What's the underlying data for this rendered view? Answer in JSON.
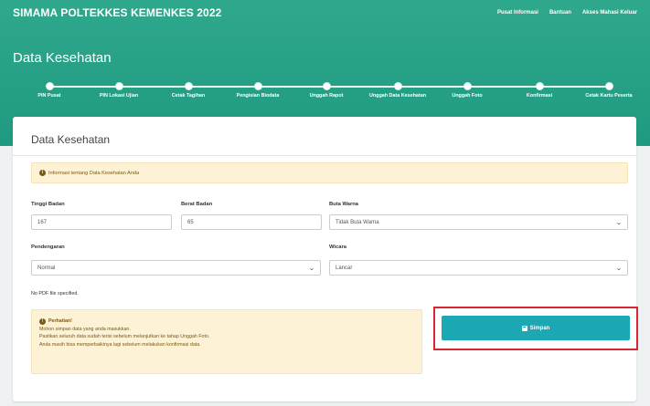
{
  "app": {
    "title": "SIMAMA POLTEKKES KEMENKES 2022"
  },
  "topnav": {
    "links": [
      "Pusat Informasi",
      "Bantuan",
      "Akses Mahasi Keluar"
    ]
  },
  "page": {
    "title": "Data Kesehatan"
  },
  "steps": [
    {
      "label": "PIN Pusat"
    },
    {
      "label": "PIN Lokasi Ujian"
    },
    {
      "label": "Cetak Tagihan"
    },
    {
      "label": "Pengisian Biodata"
    },
    {
      "label": "Unggah Rapot"
    },
    {
      "label": "Unggah Data Kesehatan"
    },
    {
      "label": "Unggah Foto"
    },
    {
      "label": "Konfirmasi"
    },
    {
      "label": "Cetak Kartu Peserta"
    }
  ],
  "card": {
    "title": "Data Kesehatan",
    "info": "Informasi tentang Data Kesehatan Anda",
    "fields": {
      "tinggi": {
        "label": "Tinggi Badan",
        "value": "167"
      },
      "berat": {
        "label": "Berat Badan",
        "value": "65"
      },
      "buta_warna": {
        "label": "Buta Warna",
        "value": "Tidak Buta Warna"
      },
      "pendengaran": {
        "label": "Pendengaran",
        "value": "Normal"
      },
      "wicara": {
        "label": "Wicara",
        "value": "Lancar"
      }
    },
    "note": "No PDF file specified.",
    "warning": {
      "title": "Perhatian!",
      "lines": [
        "Mohon simpan data yang anda masukkan.",
        "Pastikan seluruh data sudah terisi sebelum melanjutkan ke tahap Unggah Foto.",
        "Anda masih bisa memperbaikinya lagi sebelum melakukan konfirmasi data."
      ]
    },
    "save_label": "Simpan"
  },
  "colors": {
    "header": "#1f9a80",
    "button": "#1ba7b3",
    "highlight": "#d62630",
    "alert_bg": "#fdf1d6"
  }
}
